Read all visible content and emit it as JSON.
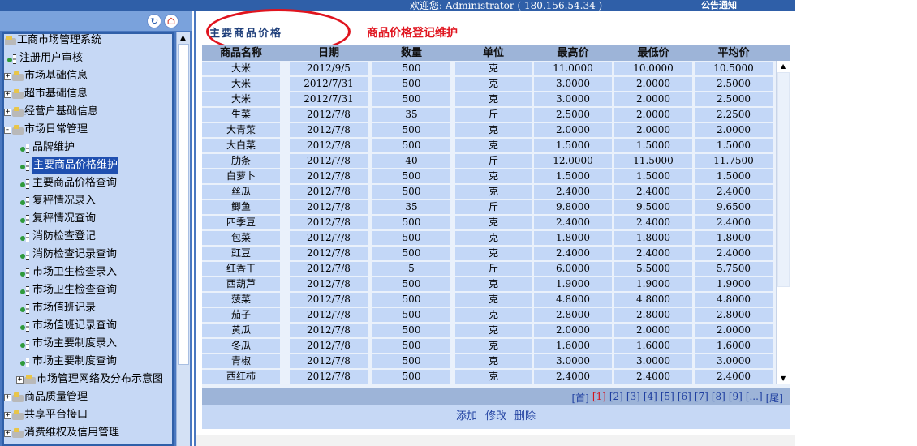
{
  "header": {
    "welcome": "欢迎您: Administrator ( 180.156.54.34 )",
    "notice": "公告通知"
  },
  "tree": {
    "nodes": [
      {
        "label": "工商市场管理系统",
        "type": "folder-open",
        "expander": ""
      },
      {
        "label": "注册用户审核",
        "type": "leaf",
        "expander": ""
      },
      {
        "label": "市场基础信息",
        "type": "folder",
        "expander": "+"
      },
      {
        "label": "超市基础信息",
        "type": "folder",
        "expander": "+"
      },
      {
        "label": "经营户基础信息",
        "type": "folder",
        "expander": "+"
      },
      {
        "label": "市场日常管理",
        "type": "folder-open",
        "expander": "-"
      },
      {
        "label": "品牌维护",
        "type": "leaf",
        "expander": ""
      },
      {
        "label": "主要商品价格维护",
        "type": "leaf",
        "expander": "",
        "selected": true
      },
      {
        "label": "主要商品价格查询",
        "type": "leaf",
        "expander": ""
      },
      {
        "label": "复秤情况录入",
        "type": "leaf",
        "expander": ""
      },
      {
        "label": "复秤情况查询",
        "type": "leaf",
        "expander": ""
      },
      {
        "label": "消防检查登记",
        "type": "leaf",
        "expander": ""
      },
      {
        "label": "消防检查记录查询",
        "type": "leaf",
        "expander": ""
      },
      {
        "label": "市场卫生检查录入",
        "type": "leaf",
        "expander": ""
      },
      {
        "label": "市场卫生检查查询",
        "type": "leaf",
        "expander": ""
      },
      {
        "label": "市场值班记录",
        "type": "leaf",
        "expander": ""
      },
      {
        "label": "市场值班记录查询",
        "type": "leaf",
        "expander": ""
      },
      {
        "label": "市场主要制度录入",
        "type": "leaf",
        "expander": ""
      },
      {
        "label": "市场主要制度查询",
        "type": "leaf",
        "expander": ""
      },
      {
        "label": "市场管理网络及分布示意图",
        "type": "folder",
        "expander": "+"
      },
      {
        "label": "商品质量管理",
        "type": "folder",
        "expander": "+"
      },
      {
        "label": "共享平台接口",
        "type": "folder",
        "expander": "+"
      },
      {
        "label": "消费维权及信用管理",
        "type": "folder",
        "expander": "+"
      }
    ]
  },
  "page": {
    "title": "主要商品价格",
    "annotation": "商品价格登记维护"
  },
  "grid": {
    "columns": [
      "商品名称",
      "日期",
      "数量",
      "单位",
      "最高价",
      "最低价",
      "平均价"
    ],
    "rows": [
      [
        "大米",
        "2012/9/5",
        "500",
        "克",
        "11.0000",
        "10.0000",
        "10.5000"
      ],
      [
        "大米",
        "2012/7/31",
        "500",
        "克",
        "3.0000",
        "2.0000",
        "2.5000"
      ],
      [
        "大米",
        "2012/7/31",
        "500",
        "克",
        "3.0000",
        "2.0000",
        "2.5000"
      ],
      [
        "生菜",
        "2012/7/8",
        "35",
        "斤",
        "2.5000",
        "2.0000",
        "2.2500"
      ],
      [
        "大青菜",
        "2012/7/8",
        "500",
        "克",
        "2.0000",
        "2.0000",
        "2.0000"
      ],
      [
        "大白菜",
        "2012/7/8",
        "500",
        "克",
        "1.5000",
        "1.5000",
        "1.5000"
      ],
      [
        "肋条",
        "2012/7/8",
        "40",
        "斤",
        "12.0000",
        "11.5000",
        "11.7500"
      ],
      [
        "白萝卜",
        "2012/7/8",
        "500",
        "克",
        "1.5000",
        "1.5000",
        "1.5000"
      ],
      [
        "丝瓜",
        "2012/7/8",
        "500",
        "克",
        "2.4000",
        "2.4000",
        "2.4000"
      ],
      [
        "鲫鱼",
        "2012/7/8",
        "35",
        "斤",
        "9.8000",
        "9.5000",
        "9.6500"
      ],
      [
        "四季豆",
        "2012/7/8",
        "500",
        "克",
        "2.4000",
        "2.4000",
        "2.4000"
      ],
      [
        "包菜",
        "2012/7/8",
        "500",
        "克",
        "1.8000",
        "1.8000",
        "1.8000"
      ],
      [
        "豇豆",
        "2012/7/8",
        "500",
        "克",
        "2.4000",
        "2.4000",
        "2.4000"
      ],
      [
        "红香干",
        "2012/7/8",
        "5",
        "斤",
        "6.0000",
        "5.5000",
        "5.7500"
      ],
      [
        "西葫芦",
        "2012/7/8",
        "500",
        "克",
        "1.9000",
        "1.9000",
        "1.9000"
      ],
      [
        "菠菜",
        "2012/7/8",
        "500",
        "克",
        "4.8000",
        "4.8000",
        "4.8000"
      ],
      [
        "茄子",
        "2012/7/8",
        "500",
        "克",
        "2.8000",
        "2.8000",
        "2.8000"
      ],
      [
        "黄瓜",
        "2012/7/8",
        "500",
        "克",
        "2.0000",
        "2.0000",
        "2.0000"
      ],
      [
        "冬瓜",
        "2012/7/8",
        "500",
        "克",
        "1.6000",
        "1.6000",
        "1.6000"
      ],
      [
        "青椒",
        "2012/7/8",
        "500",
        "克",
        "3.0000",
        "3.0000",
        "3.0000"
      ],
      [
        "西红柿",
        "2012/7/8",
        "500",
        "克",
        "2.4000",
        "2.4000",
        "2.4000"
      ]
    ]
  },
  "pager": {
    "items": [
      "[首]",
      "[1]",
      "[2]",
      "[3]",
      "[4]",
      "[5]",
      "[6]",
      "[7]",
      "[8]",
      "[9]",
      "[...]",
      "[尾]"
    ],
    "current_index": 1
  },
  "actions": {
    "add": "添加",
    "edit": "修改",
    "delete": "删除"
  },
  "colors": {
    "topbar": "#2f5fa8",
    "panel": "#4a78c0",
    "tree_bg": "#c6d8f5",
    "cell_bg": "#c3d7f7",
    "header_bg": "#9db4d8",
    "annotation": "#e0141e",
    "link": "#1f3fa0"
  }
}
